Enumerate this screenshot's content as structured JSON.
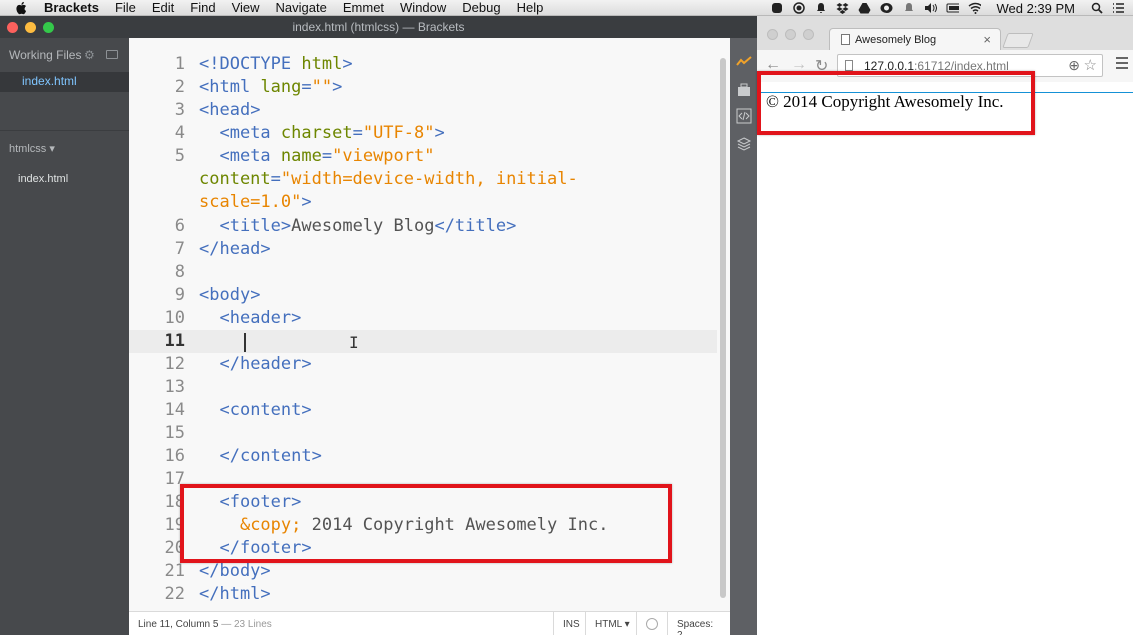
{
  "menubar": {
    "app_name": "Brackets",
    "items": [
      "File",
      "Edit",
      "Find",
      "View",
      "Navigate",
      "Emmet",
      "Window",
      "Debug",
      "Help"
    ],
    "clock": "Wed 2:39 PM"
  },
  "brackets": {
    "window_title": "index.html (htmlcss) — Brackets",
    "sidebar": {
      "working_files_label": "Working Files",
      "working_files": [
        "index.html"
      ],
      "project_name": "htmlcss",
      "project_files": [
        "index.html"
      ]
    },
    "code": {
      "gutter": [
        "1",
        "2",
        "3",
        "4",
        "5",
        "",
        "",
        "6",
        "7",
        "8",
        "9",
        "10",
        "11",
        "12",
        "13",
        "14",
        "15",
        "16",
        "17",
        "18",
        "19",
        "20",
        "21",
        "22"
      ],
      "active_line": "11",
      "lines": [
        "<!DOCTYPE html>",
        "<html lang=\"\">",
        "<head>",
        "  <meta charset=\"UTF-8\">",
        "  <meta name=\"viewport\"",
        "content=\"width=device-width, initial-",
        "scale=1.0\">",
        "  <title>Awesomely Blog</title>",
        "</head>",
        "",
        "<body>",
        "  <header>",
        "",
        "  </header>",
        "",
        "  <content>",
        "",
        "  </content>",
        "",
        "  <footer>",
        "    &copy; 2014 Copyright Awesomely Inc.",
        "  </footer>",
        "</body>",
        "</html>"
      ]
    },
    "statusbar": {
      "position": "Line 11, Column 5",
      "line_count": " — 23 Lines",
      "mode": "INS",
      "language": "HTML",
      "spaces": "Spaces: 2"
    }
  },
  "browser": {
    "tab_title": "Awesomely Blog",
    "url_host": "127.0.0.1",
    "url_rest": ":61712/index.html",
    "page_text": "© 2014 Copyright Awesomely Inc."
  },
  "colors": {
    "highlight": "#e1141b",
    "tag": "#446fbd",
    "attribute": "#6d8600",
    "string": "#e88501",
    "sidebar_bg": "#47494c"
  }
}
